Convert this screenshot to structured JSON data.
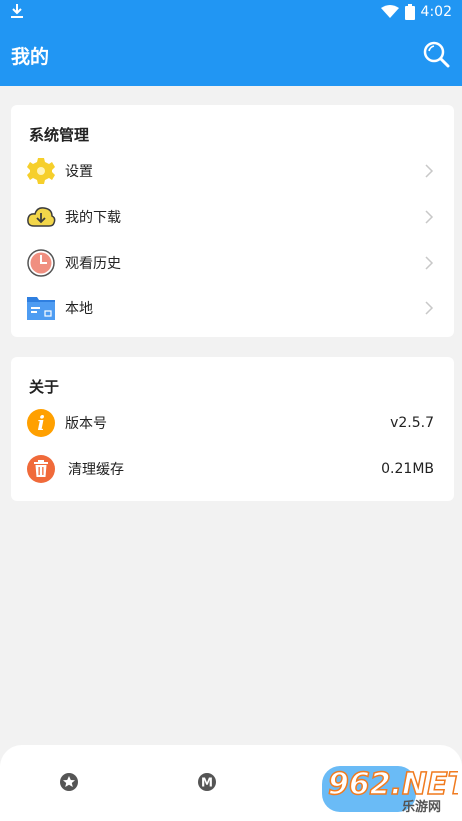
{
  "status_bar": {
    "time": "4:02"
  },
  "header": {
    "title": "我的"
  },
  "system_section": {
    "title": "系统管理",
    "items": [
      {
        "label": "设置",
        "icon": "gear-icon"
      },
      {
        "label": "我的下载",
        "icon": "cloud-download-icon"
      },
      {
        "label": "观看历史",
        "icon": "clock-icon"
      },
      {
        "label": "本地",
        "icon": "folder-icon"
      }
    ]
  },
  "about_section": {
    "title": "关于",
    "items": [
      {
        "label": "版本号",
        "value": "v2.5.7",
        "icon": "info-icon"
      },
      {
        "label": "清理缓存",
        "value": "0.21MB",
        "icon": "trash-icon"
      }
    ]
  },
  "bottom_nav": {
    "items": [
      {
        "icon": "star-icon"
      },
      {
        "icon": "m-icon",
        "glyph": "M"
      }
    ]
  },
  "watermark": {
    "text": "962.NET",
    "sub": "乐游网"
  },
  "colors": {
    "primary": "#2196f3",
    "background": "#f2f2f2",
    "info": "#ffa000",
    "trash": "#f06a3a"
  }
}
